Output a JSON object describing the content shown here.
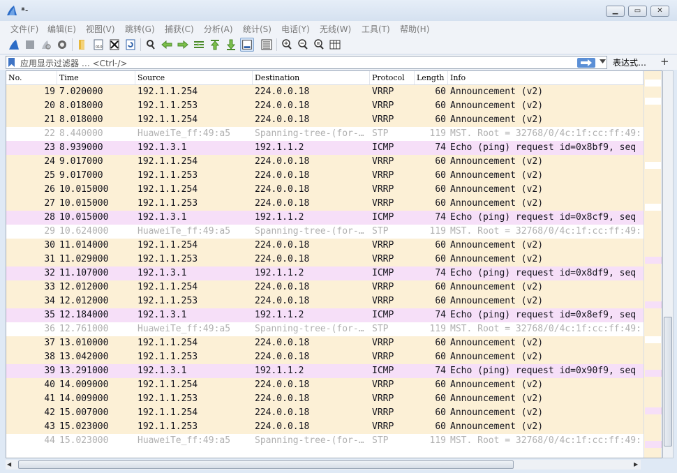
{
  "window": {
    "title": "*-",
    "minimize_label": "▁",
    "restore_label": "▭",
    "close_label": "✕"
  },
  "menu": [
    "文件(F)",
    "编辑(E)",
    "视图(V)",
    "跳转(G)",
    "捕获(C)",
    "分析(A)",
    "统计(S)",
    "电话(Y)",
    "无线(W)",
    "工具(T)",
    "帮助(H)"
  ],
  "filter": {
    "placeholder": "应用显示过滤器 … <Ctrl-/>",
    "expression_label": "表达式…",
    "add_label": "+"
  },
  "columns": [
    "No.",
    "Time",
    "Source",
    "Destination",
    "Protocol",
    "Length",
    "Info"
  ],
  "packets": [
    {
      "no": "19",
      "time": "7.020000",
      "src": "192.1.1.254",
      "dst": "224.0.0.18",
      "proto": "VRRP",
      "len": "60",
      "info": "Announcement (v2)",
      "type": "vrrp"
    },
    {
      "no": "20",
      "time": "8.018000",
      "src": "192.1.1.253",
      "dst": "224.0.0.18",
      "proto": "VRRP",
      "len": "60",
      "info": "Announcement (v2)",
      "type": "vrrp"
    },
    {
      "no": "21",
      "time": "8.018000",
      "src": "192.1.1.254",
      "dst": "224.0.0.18",
      "proto": "VRRP",
      "len": "60",
      "info": "Announcement (v2)",
      "type": "vrrp"
    },
    {
      "no": "22",
      "time": "8.440000",
      "src": "HuaweiTe_ff:49:a5",
      "dst": "Spanning-tree-(for-…",
      "proto": "STP",
      "len": "119",
      "info": "MST. Root = 32768/0/4c:1f:cc:ff:49:",
      "type": "stp"
    },
    {
      "no": "23",
      "time": "8.939000",
      "src": "192.1.3.1",
      "dst": "192.1.1.2",
      "proto": "ICMP",
      "len": "74",
      "info": "Echo (ping) request  id=0x8bf9, seq",
      "type": "icmp"
    },
    {
      "no": "24",
      "time": "9.017000",
      "src": "192.1.1.254",
      "dst": "224.0.0.18",
      "proto": "VRRP",
      "len": "60",
      "info": "Announcement (v2)",
      "type": "vrrp"
    },
    {
      "no": "25",
      "time": "9.017000",
      "src": "192.1.1.253",
      "dst": "224.0.0.18",
      "proto": "VRRP",
      "len": "60",
      "info": "Announcement (v2)",
      "type": "vrrp"
    },
    {
      "no": "26",
      "time": "10.015000",
      "src": "192.1.1.254",
      "dst": "224.0.0.18",
      "proto": "VRRP",
      "len": "60",
      "info": "Announcement (v2)",
      "type": "vrrp"
    },
    {
      "no": "27",
      "time": "10.015000",
      "src": "192.1.1.253",
      "dst": "224.0.0.18",
      "proto": "VRRP",
      "len": "60",
      "info": "Announcement (v2)",
      "type": "vrrp"
    },
    {
      "no": "28",
      "time": "10.015000",
      "src": "192.1.3.1",
      "dst": "192.1.1.2",
      "proto": "ICMP",
      "len": "74",
      "info": "Echo (ping) request  id=0x8cf9, seq",
      "type": "icmp"
    },
    {
      "no": "29",
      "time": "10.624000",
      "src": "HuaweiTe_ff:49:a5",
      "dst": "Spanning-tree-(for-…",
      "proto": "STP",
      "len": "119",
      "info": "MST. Root = 32768/0/4c:1f:cc:ff:49:",
      "type": "stp"
    },
    {
      "no": "30",
      "time": "11.014000",
      "src": "192.1.1.254",
      "dst": "224.0.0.18",
      "proto": "VRRP",
      "len": "60",
      "info": "Announcement (v2)",
      "type": "vrrp"
    },
    {
      "no": "31",
      "time": "11.029000",
      "src": "192.1.1.253",
      "dst": "224.0.0.18",
      "proto": "VRRP",
      "len": "60",
      "info": "Announcement (v2)",
      "type": "vrrp"
    },
    {
      "no": "32",
      "time": "11.107000",
      "src": "192.1.3.1",
      "dst": "192.1.1.2",
      "proto": "ICMP",
      "len": "74",
      "info": "Echo (ping) request  id=0x8df9, seq",
      "type": "icmp"
    },
    {
      "no": "33",
      "time": "12.012000",
      "src": "192.1.1.254",
      "dst": "224.0.0.18",
      "proto": "VRRP",
      "len": "60",
      "info": "Announcement (v2)",
      "type": "vrrp"
    },
    {
      "no": "34",
      "time": "12.012000",
      "src": "192.1.1.253",
      "dst": "224.0.0.18",
      "proto": "VRRP",
      "len": "60",
      "info": "Announcement (v2)",
      "type": "vrrp"
    },
    {
      "no": "35",
      "time": "12.184000",
      "src": "192.1.3.1",
      "dst": "192.1.1.2",
      "proto": "ICMP",
      "len": "74",
      "info": "Echo (ping) request  id=0x8ef9, seq",
      "type": "icmp"
    },
    {
      "no": "36",
      "time": "12.761000",
      "src": "HuaweiTe_ff:49:a5",
      "dst": "Spanning-tree-(for-…",
      "proto": "STP",
      "len": "119",
      "info": "MST. Root = 32768/0/4c:1f:cc:ff:49:",
      "type": "stp"
    },
    {
      "no": "37",
      "time": "13.010000",
      "src": "192.1.1.254",
      "dst": "224.0.0.18",
      "proto": "VRRP",
      "len": "60",
      "info": "Announcement (v2)",
      "type": "vrrp"
    },
    {
      "no": "38",
      "time": "13.042000",
      "src": "192.1.1.253",
      "dst": "224.0.0.18",
      "proto": "VRRP",
      "len": "60",
      "info": "Announcement (v2)",
      "type": "vrrp"
    },
    {
      "no": "39",
      "time": "13.291000",
      "src": "192.1.3.1",
      "dst": "192.1.1.2",
      "proto": "ICMP",
      "len": "74",
      "info": "Echo (ping) request  id=0x90f9, seq",
      "type": "icmp"
    },
    {
      "no": "40",
      "time": "14.009000",
      "src": "192.1.1.254",
      "dst": "224.0.0.18",
      "proto": "VRRP",
      "len": "60",
      "info": "Announcement (v2)",
      "type": "vrrp"
    },
    {
      "no": "41",
      "time": "14.009000",
      "src": "192.1.1.253",
      "dst": "224.0.0.18",
      "proto": "VRRP",
      "len": "60",
      "info": "Announcement (v2)",
      "type": "vrrp"
    },
    {
      "no": "42",
      "time": "15.007000",
      "src": "192.1.1.254",
      "dst": "224.0.0.18",
      "proto": "VRRP",
      "len": "60",
      "info": "Announcement (v2)",
      "type": "vrrp"
    },
    {
      "no": "43",
      "time": "15.023000",
      "src": "192.1.1.253",
      "dst": "224.0.0.18",
      "proto": "VRRP",
      "len": "60",
      "info": "Announcement (v2)",
      "type": "vrrp"
    },
    {
      "no": "44",
      "time": "15.023000",
      "src": "HuaweiTe_ff:49:a5",
      "dst": "Spanning-tree-(for-…",
      "proto": "STP",
      "len": "119",
      "info": "MST. Root = 32768/0/4c:1f:cc:ff:49:",
      "type": "stp"
    }
  ],
  "colors": {
    "vrrp_row": "#fcf0d6",
    "icmp_row": "#f6dff8",
    "stp_text": "#b0b0b0"
  },
  "icons": [
    "shark-fin-start-icon",
    "stop-capture-icon",
    "restart-capture-icon",
    "capture-options-icon",
    "open-file-icon",
    "save-file-icon",
    "close-file-icon",
    "reload-file-icon",
    "find-packet-icon",
    "go-back-icon",
    "go-forward-icon",
    "go-to-packet-icon",
    "go-first-icon",
    "go-last-icon",
    "auto-scroll-icon",
    "colorize-icon",
    "zoom-in-icon",
    "zoom-out-icon",
    "zoom-normal-icon",
    "resize-columns-icon"
  ]
}
